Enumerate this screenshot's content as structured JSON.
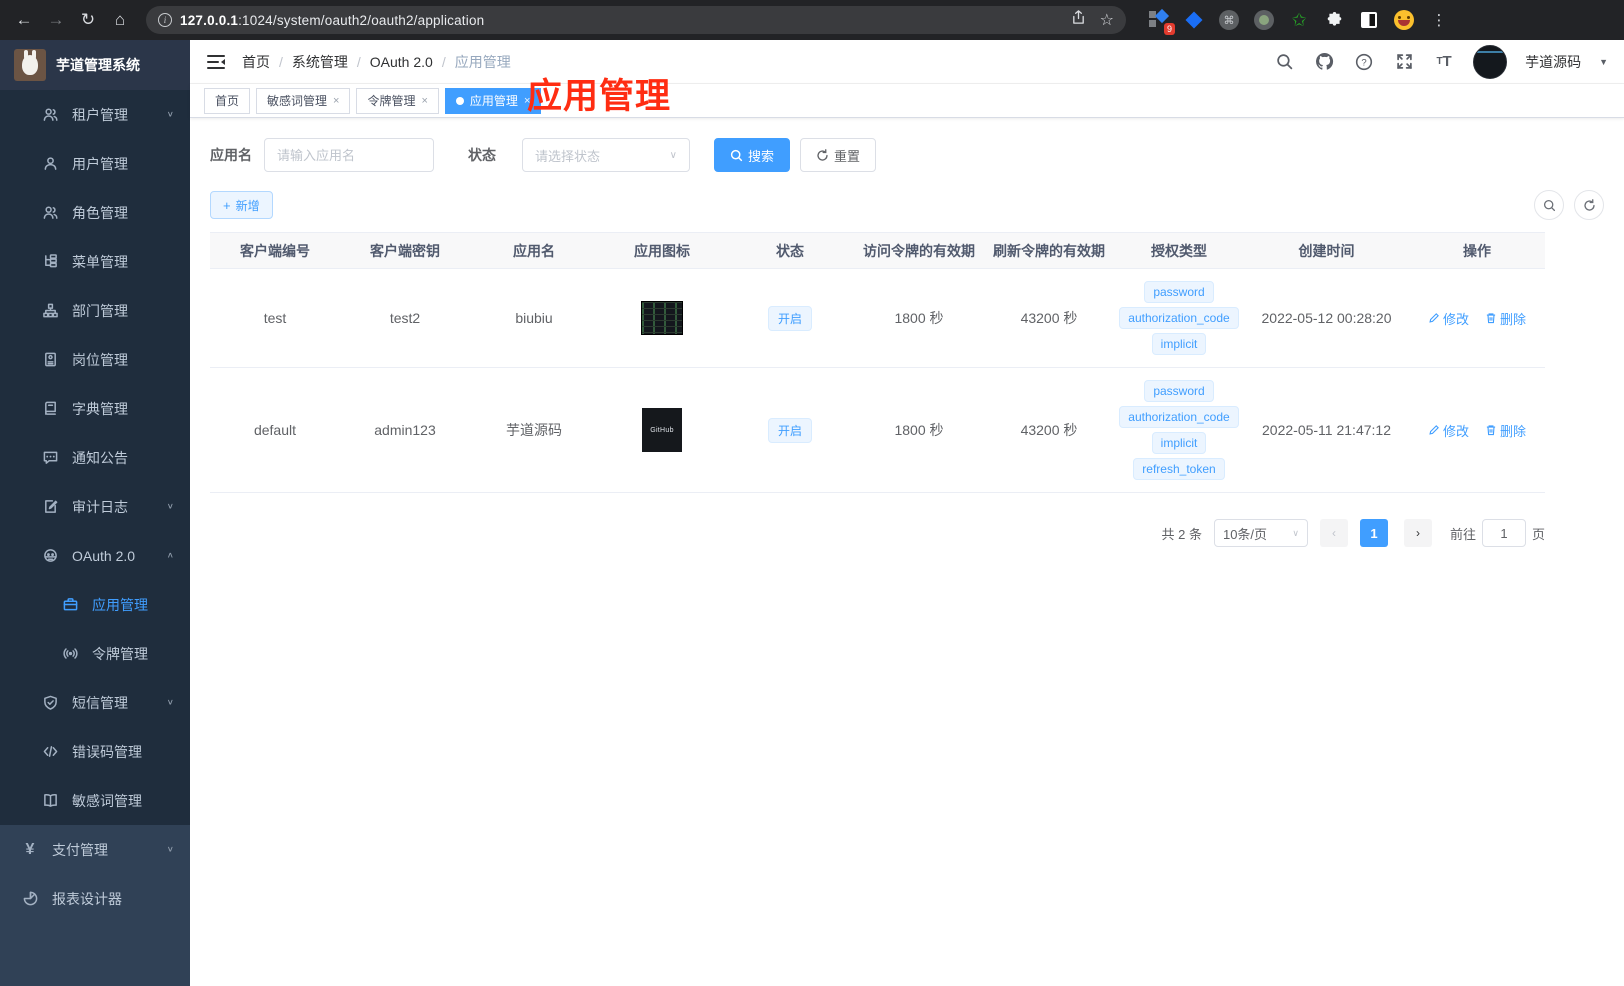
{
  "browser": {
    "url_host": "127.0.0.1",
    "url_rest": ":1024/system/oauth2/oauth2/application",
    "extension_badge": "9"
  },
  "sidebar": {
    "title": "芋道管理系统",
    "items": [
      {
        "label": "租户管理",
        "icon": "users-icon",
        "arrow": "v"
      },
      {
        "label": "用户管理",
        "icon": "user-icon"
      },
      {
        "label": "角色管理",
        "icon": "users-icon"
      },
      {
        "label": "菜单管理",
        "icon": "tree-menu-icon"
      },
      {
        "label": "部门管理",
        "icon": "org-chart-icon"
      },
      {
        "label": "岗位管理",
        "icon": "badge-icon"
      },
      {
        "label": "字典管理",
        "icon": "dictionary-icon"
      },
      {
        "label": "通知公告",
        "icon": "message-icon"
      },
      {
        "label": "审计日志",
        "icon": "log-icon",
        "arrow": "v"
      },
      {
        "label": "OAuth 2.0",
        "icon": "robot-icon",
        "arrow": "^"
      },
      {
        "label": "应用管理",
        "icon": "briefcase-icon",
        "child": true,
        "active": true
      },
      {
        "label": "令牌管理",
        "icon": "broadcast-icon",
        "child": true
      },
      {
        "label": "短信管理",
        "icon": "shield-icon",
        "arrow": "v"
      },
      {
        "label": "错误码管理",
        "icon": "code-icon"
      },
      {
        "label": "敏感词管理",
        "icon": "open-book-icon"
      },
      {
        "label": "支付管理",
        "icon": "yen-icon",
        "arrow": "v",
        "top": true,
        "yen": "¥"
      },
      {
        "label": "报表设计器",
        "icon": "report-icon",
        "top": true
      }
    ]
  },
  "header": {
    "breadcrumb": [
      "首页",
      "系统管理",
      "OAuth 2.0",
      "应用管理"
    ],
    "username": "芋道源码"
  },
  "tags_view": {
    "tabs": [
      {
        "label": "首页"
      },
      {
        "label": "敏感词管理",
        "closable": true
      },
      {
        "label": "令牌管理",
        "closable": true
      },
      {
        "label": "应用管理",
        "closable": true,
        "active": true
      }
    ]
  },
  "annotation": "应用管理",
  "filter": {
    "name_label": "应用名",
    "name_placeholder": "请输入应用名",
    "status_label": "状态",
    "status_placeholder": "请选择状态",
    "search_label": "搜索",
    "reset_label": "重置"
  },
  "toolbar": {
    "add_label": "新增"
  },
  "table": {
    "headers": [
      "客户端编号",
      "客户端密钥",
      "应用名",
      "应用图标",
      "状态",
      "访问令牌的有效期",
      "刷新令牌的有效期",
      "授权类型",
      "创建时间",
      "操作"
    ],
    "rows": [
      {
        "client_id": "test",
        "secret": "test2",
        "name": "biubiu",
        "icon": "terminal-screenshot-thumbnail",
        "status": "开启",
        "access_ttl": "1800 秒",
        "refresh_ttl": "43200 秒",
        "grants": [
          "password",
          "authorization_code",
          "implicit"
        ],
        "created": "2022-05-12 00:28:20",
        "edit_label": "修改",
        "delete_label": "删除"
      },
      {
        "client_id": "default",
        "secret": "admin123",
        "name": "芋道源码",
        "icon": "github-dark-logo",
        "icon_text": "GitHub",
        "status": "开启",
        "access_ttl": "1800 秒",
        "refresh_ttl": "43200 秒",
        "grants": [
          "password",
          "authorization_code",
          "implicit",
          "refresh_token"
        ],
        "created": "2022-05-11 21:47:12",
        "edit_label": "修改",
        "delete_label": "删除"
      }
    ]
  },
  "pagination": {
    "total": "共 2 条",
    "page_size": "10条/页",
    "current_page": "1",
    "goto_label": "前往",
    "goto_value": "1",
    "page_unit": "页"
  }
}
